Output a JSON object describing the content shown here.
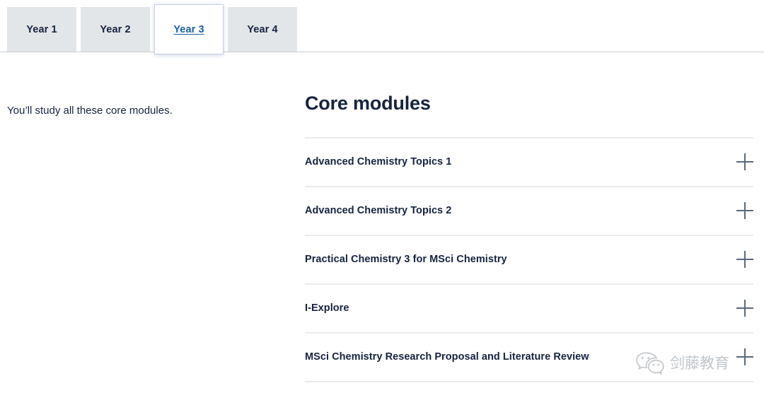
{
  "tabs": {
    "items": [
      {
        "label": "Year 1",
        "active": false
      },
      {
        "label": "Year 2",
        "active": false
      },
      {
        "label": "Year 3",
        "active": true
      },
      {
        "label": "Year 4",
        "active": false
      }
    ]
  },
  "intro": {
    "text": "You’ll study all these core modules."
  },
  "modules": {
    "title": "Core modules",
    "items": [
      {
        "label": "Advanced Chemistry Topics 1",
        "toggle_icon": "plus-icon"
      },
      {
        "label": "Advanced Chemistry Topics 2",
        "toggle_icon": "plus-icon"
      },
      {
        "label": "Practical Chemistry 3 for MSci Chemistry",
        "toggle_icon": "plus-icon"
      },
      {
        "label": "I-Explore",
        "toggle_icon": "plus-icon"
      },
      {
        "label": "MSci Chemistry Research Proposal and Literature Review",
        "toggle_icon": "plus-icon"
      }
    ]
  },
  "watermark": {
    "icon": "wechat-icon",
    "text": "剑藤教育"
  },
  "colors": {
    "navy": "#15233f",
    "link_blue": "#1a5fa8",
    "tab_inactive_bg": "#e3e6e8",
    "divider": "#e9ecee",
    "toggle": "#5a6a7d",
    "watermark": "#9aa2ab"
  }
}
